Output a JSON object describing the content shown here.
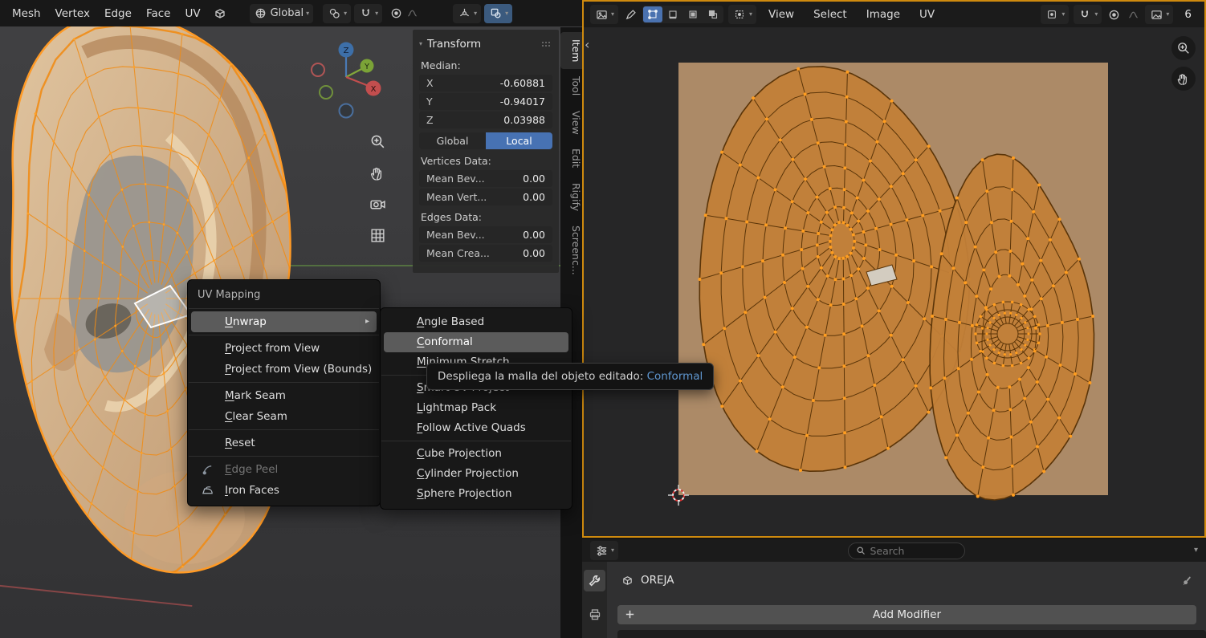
{
  "viewport": {
    "header": {
      "menus": [
        "Mesh",
        "Vertex",
        "Edge",
        "Face",
        "UV"
      ],
      "orientation": "Global"
    },
    "gizmo": {
      "x": "X",
      "y": "Y",
      "z": "Z"
    },
    "tabs": [
      "Item",
      "Tool",
      "View",
      "Edit",
      "Rigify",
      "Screenc..."
    ],
    "transform": {
      "title": "Transform",
      "median_label": "Median:",
      "median": [
        {
          "axis": "X",
          "value": "-0.60881"
        },
        {
          "axis": "Y",
          "value": "-0.94017"
        },
        {
          "axis": "Z",
          "value": "0.03988"
        }
      ],
      "space": [
        "Global",
        "Local"
      ],
      "vertices_label": "Vertices Data:",
      "vrows": [
        {
          "label": "Mean Bev...",
          "value": "0.00"
        },
        {
          "label": "Mean Vert...",
          "value": "0.00"
        }
      ],
      "edges_label": "Edges Data:",
      "erows": [
        {
          "label": "Mean Bev...",
          "value": "0.00"
        },
        {
          "label": "Mean Crea...",
          "value": "0.00"
        }
      ]
    },
    "context_menu": {
      "title": "UV Mapping",
      "items": [
        {
          "label": "Unwrap"
        },
        {
          "label": "Project from View"
        },
        {
          "label": "Project from View (Bounds)"
        },
        {
          "label": "Mark Seam"
        },
        {
          "label": "Clear Seam"
        },
        {
          "label": "Reset"
        },
        {
          "label": "Edge Peel"
        },
        {
          "label": "Iron Faces"
        }
      ]
    },
    "submenu": {
      "items": [
        {
          "label": "Angle Based"
        },
        {
          "label": "Conformal"
        },
        {
          "label": "Minimum Stretch"
        },
        {
          "label": "Smart UV Project"
        },
        {
          "label": "Lightmap Pack"
        },
        {
          "label": "Follow Active Quads"
        },
        {
          "label": "Cube Projection"
        },
        {
          "label": "Cylinder Projection"
        },
        {
          "label": "Sphere Projection"
        }
      ]
    },
    "tooltip": {
      "text": "Despliega la malla del objeto editado: ",
      "value": "Conformal"
    }
  },
  "uv": {
    "menus": [
      "View",
      "Select",
      "Image",
      "UV"
    ],
    "value": "6"
  },
  "props": {
    "search_placeholder": "Search",
    "object_name": "OREJA",
    "add_modifier": "Add Modifier"
  }
}
